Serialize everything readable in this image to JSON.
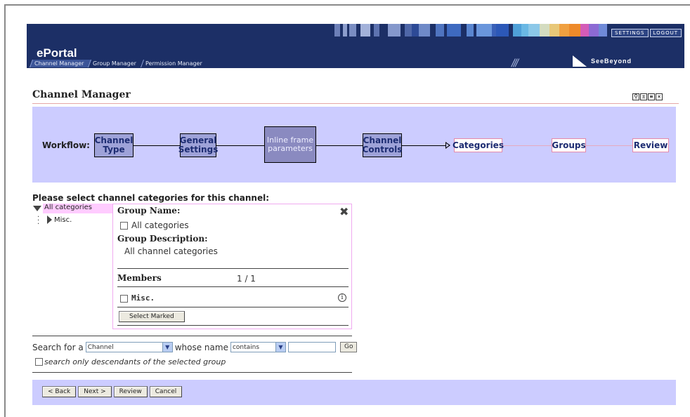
{
  "header": {
    "app_title": "ePortal",
    "nav_tabs": [
      "Channel Manager",
      "Group Manager",
      "Permission Manager"
    ],
    "settings_label": "SETTINGS",
    "logout_label": "LOGOUT",
    "logo_text": "SeeBeyond",
    "colors": {
      "banner": "#1c2f66",
      "workflow_bg": "#ccccff"
    }
  },
  "page": {
    "title": "Channel Manager"
  },
  "workflow": {
    "label": "Workflow:",
    "steps": [
      {
        "label": "Channel Type",
        "state": "done"
      },
      {
        "label": "General Settings",
        "state": "done"
      },
      {
        "label": "Inline frame parameters",
        "state": "disabled"
      },
      {
        "label": "Channel Controls",
        "state": "done"
      },
      {
        "label": "Categories",
        "state": "current"
      },
      {
        "label": "Groups",
        "state": "todo"
      },
      {
        "label": "Review",
        "state": "todo"
      }
    ]
  },
  "instruction": "Please select channel categories for this channel:",
  "tree": {
    "root_label": "All categories",
    "children": [
      "Misc."
    ]
  },
  "panel": {
    "group_name_heading": "Group Name:",
    "group_name_value": "All categories",
    "group_description_heading": "Group Description:",
    "group_description_value": "All channel categories",
    "members_heading": "Members",
    "members_count": "1 / 1",
    "members": [
      "Misc."
    ],
    "select_marked_button": "Select Marked"
  },
  "search": {
    "prefix": "Search for a",
    "type_value": "Channel",
    "mid_text": "whose name",
    "op_value": "contains",
    "query_value": "",
    "go_label": "Go",
    "descendants_label": "search only descendants of the selected group"
  },
  "footer": {
    "back_label": "< Back",
    "next_label": "Next >",
    "review_label": "Review",
    "cancel_label": "Cancel"
  }
}
